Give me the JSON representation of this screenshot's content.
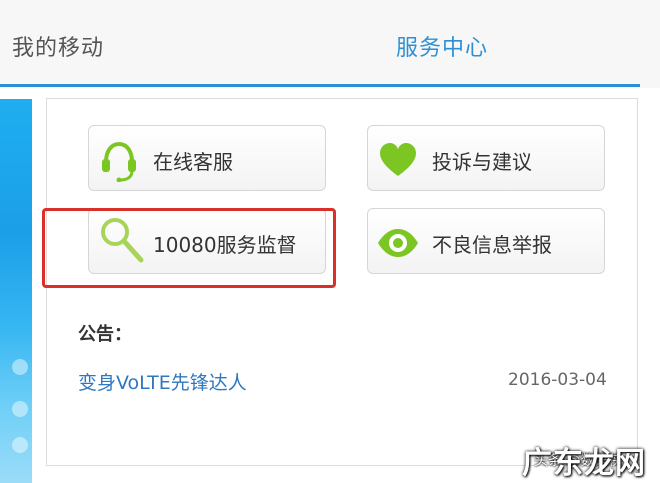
{
  "tabs": {
    "mine": "我的移动",
    "service_center": "服务中心"
  },
  "colors": {
    "accent_blue": "#2e8fd6",
    "icon_green": "#7cc623",
    "highlight_red": "#d9302a",
    "link_blue": "#2f78c0"
  },
  "services": [
    {
      "label": "在线客服",
      "icon": "headset-icon"
    },
    {
      "label": "投诉与建议",
      "icon": "heart-icon"
    },
    {
      "label": "10080服务监督",
      "icon": "magnifier-icon"
    },
    {
      "label": "不良信息举报",
      "icon": "eye-icon"
    }
  ],
  "notice": {
    "title": "公告：",
    "items": [
      {
        "text": "变身VoLTE先锋达人",
        "date": "2016-03-04"
      }
    ]
  },
  "watermark": {
    "small": "头条 @数码侠",
    "big": "广东龙网"
  }
}
